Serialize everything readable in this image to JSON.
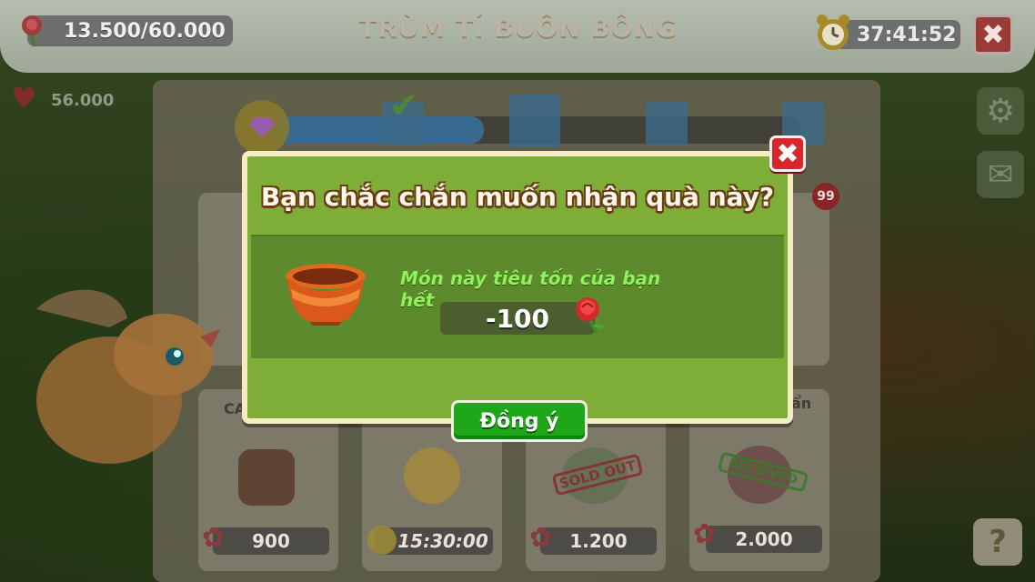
{
  "topbar": {
    "currency_value": "13.500/60.000",
    "title": "TRÙM TÍ BUÔN BÔNG",
    "timer": "37:41:52",
    "close_label": "✖"
  },
  "side": {
    "hearts_value": "56.000",
    "mail_badge": "99",
    "help_label": "?"
  },
  "progress": {
    "fill_fraction": 0.4
  },
  "cards": [
    {
      "label": "CA",
      "price": "900"
    },
    {
      "label": "",
      "price": "15:30:00"
    },
    {
      "label": "",
      "price": "1.200",
      "stamp": "SOLD OUT"
    },
    {
      "label": "ẩn",
      "price": "2.000",
      "stamp": "RECEIVED"
    }
  ],
  "dialog": {
    "question": "Bạn chắc chắn muốn nhận quà này?",
    "message": "Món này tiêu tốn của bạn hết",
    "cost": "-100",
    "confirm_label": "Đồng ý",
    "close_label": "✖"
  },
  "colors": {
    "dialog_bg": "#7fae38",
    "confirm_green": "#1fa71a",
    "close_red": "#d8262a",
    "message_green": "#8ff25a"
  }
}
